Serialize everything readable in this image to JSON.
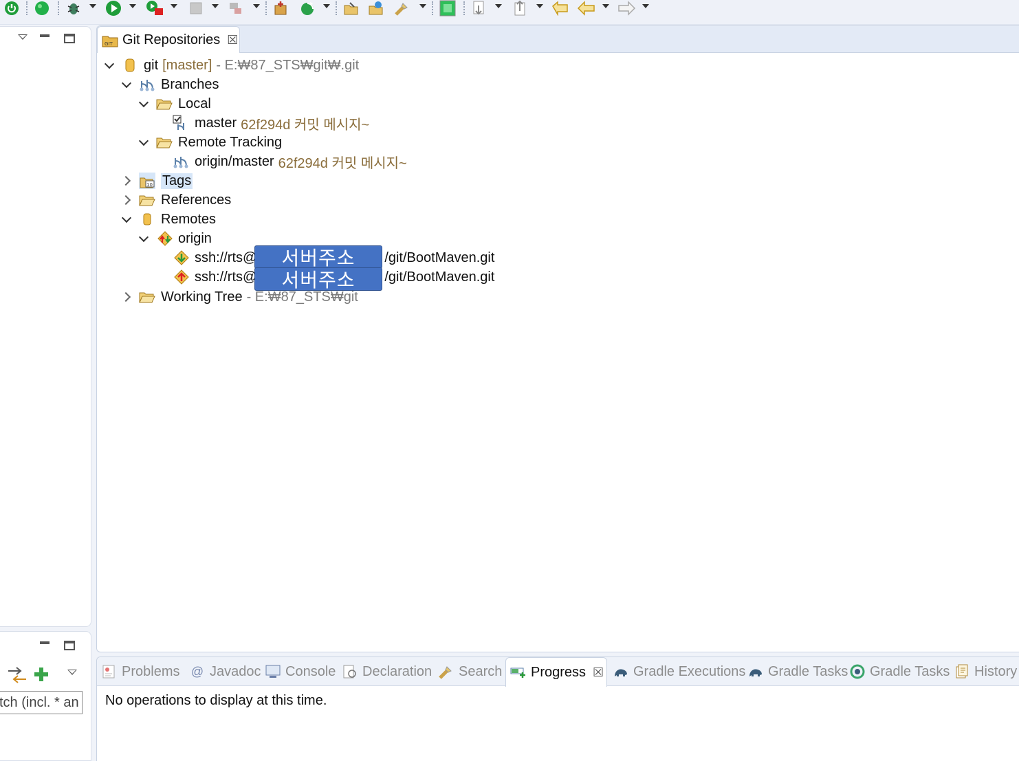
{
  "toolbar": {
    "icons": [
      "power-icon",
      "green-circle-icon",
      "debug-bug-icon",
      "run-icon",
      "run-server-icon",
      "stop-icon",
      "disconnect-icon",
      "new-package-icon",
      "refresh-icon",
      "open-type-icon",
      "open-task-icon",
      "search-torch-icon",
      "terminal-icon",
      "next-annotation-icon",
      "prev-annotation-icon",
      "last-edit-icon",
      "back-icon",
      "forward-icon"
    ]
  },
  "left_panel": {
    "filter_text": "tch (incl. * an"
  },
  "git_view": {
    "tab_title": "Git Repositories",
    "close_glyph": "☒",
    "tree": {
      "repo": {
        "name": "git",
        "branch": "[master]",
        "path": "- E:₩87_STS₩git₩.git"
      },
      "branches": "Branches",
      "local": "Local",
      "master": {
        "name": "master",
        "detail": "62f294d 커밋 메시지~"
      },
      "remote_tracking": "Remote Tracking",
      "origin_master": {
        "name": "origin/master",
        "detail": "62f294d 커밋 메시지~"
      },
      "tags": "Tags",
      "references": "References",
      "remotes": "Remotes",
      "origin": "origin",
      "fetch_url": {
        "prefix": "ssh://rts@",
        "suffix": "/git/BootMaven.git",
        "redaction": "서버주소"
      },
      "push_url": {
        "prefix": "ssh://rts@",
        "suffix": "/git/BootMaven.git",
        "redaction": "서버주소"
      },
      "working_tree": {
        "name": "Working Tree",
        "path": "- E:₩87_STS₩git"
      }
    }
  },
  "bottom_view": {
    "tabs": [
      {
        "label": "Problems",
        "icon": "problems-icon"
      },
      {
        "label": "Javadoc",
        "icon": "at-icon"
      },
      {
        "label": "Console",
        "icon": "console-icon"
      },
      {
        "label": "Declaration",
        "icon": "declaration-icon"
      },
      {
        "label": "Search",
        "icon": "search-torch-icon"
      },
      {
        "label": "Progress",
        "icon": "progress-icon"
      },
      {
        "label": "Gradle Executions",
        "icon": "gradle-elephant-icon"
      },
      {
        "label": "Gradle Tasks",
        "icon": "gradle-elephant-icon"
      },
      {
        "label": "Gradle Tasks",
        "icon": "gradle-refresh-icon"
      },
      {
        "label": "History",
        "icon": "history-icon"
      }
    ],
    "close_glyph": "☒",
    "progress_message": "No operations to display at this time."
  }
}
